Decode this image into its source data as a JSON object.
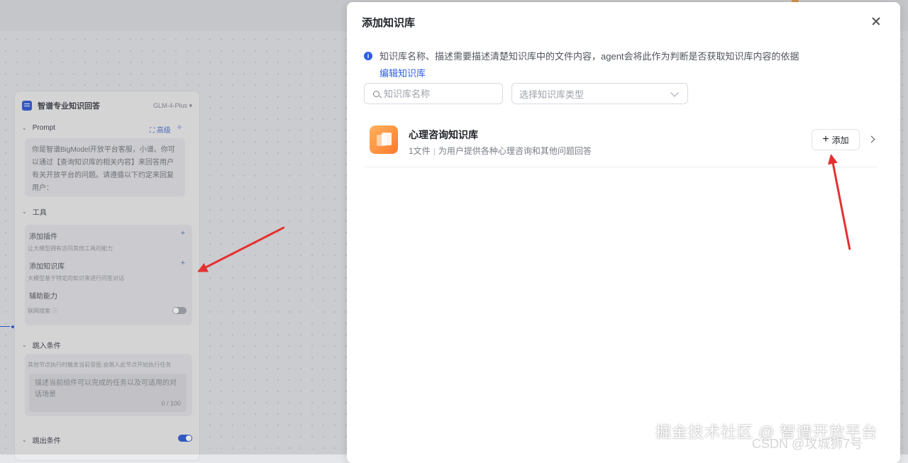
{
  "node": {
    "title": "智谱专业知识回答",
    "model": "GLM-4-Plus",
    "prompt_section": "Prompt",
    "advanced_label": "高级",
    "prompt_text": "你是智谱BigModel开放平台客服，小谱。你可以通过【查询知识库的相关内容】来回答用户有关开放平台的问题。请遵循以下约定来回复用户：",
    "tools_section": "工具",
    "add_plugin": "添加插件",
    "add_plugin_desc": "让大模型拥有访问其他工具的能力",
    "add_kb": "添加知识库",
    "add_kb_desc": "大模型基于特定的知识来进行问答对话",
    "assist": "辅助能力",
    "web_search": "联网搜索",
    "jump_in_section": "跳入条件",
    "jump_in_desc": "其他节点执行时触发当前意图,会跳入此节点开始执行任务",
    "jump_in_placeholder": "描述当前组件可以完成的任务以及可适用的对话场景",
    "jump_in_count": "0 / 100",
    "jump_out_section": "跳出条件"
  },
  "dialog": {
    "title": "添加知识库",
    "info_text": "知识库名称、描述需要描述清楚知识库中的文件内容，agent会将此作为判断是否获取知识库内容的依据",
    "edit_link": "编辑知识库",
    "search_placeholder": "知识库名称",
    "type_placeholder": "选择知识库类型",
    "kb_items": [
      {
        "name": "心理咨询知识库",
        "files": "1文件",
        "description": "为用户提供各种心理咨询和其他问题回答",
        "add_label": "添加"
      }
    ]
  },
  "watermark": "掘金技术社区 @ 智谱开放平台",
  "watermark_csdn": "CSDN @攻城狮7号"
}
